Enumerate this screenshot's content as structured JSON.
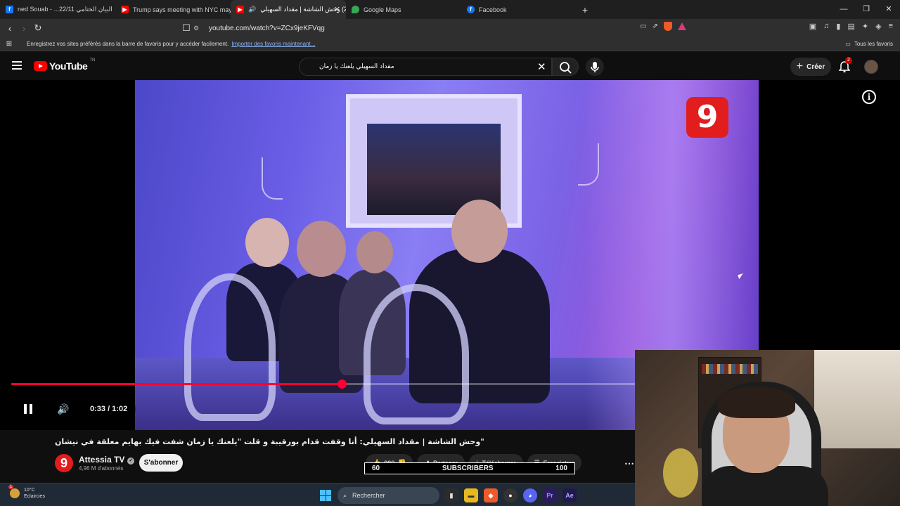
{
  "browser": {
    "tabs": [
      {
        "title": "ned Souab - ...22/11 البيان الختامي",
        "favicon": "facebook-icon",
        "color": "#1877f2"
      },
      {
        "title": "Trump says meeting with NYC mayor",
        "favicon": "youtube-icon",
        "color": "#ff0000"
      },
      {
        "title": "(2) وحش الشاشة | مقداد السهيلي",
        "favicon": "youtube-icon",
        "color": "#ff0000",
        "active": true
      },
      {
        "title": "Google Maps",
        "favicon": "maps-icon",
        "color": "#34a853"
      },
      {
        "title": "Facebook",
        "favicon": "facebook-icon",
        "color": "#1877f2"
      }
    ],
    "new_tab": "+",
    "url": "youtube.com/watch?v=ZCx9jeKFVqg",
    "bookmarks_hint": "Enregistrez vos sites préférés dans la barre de favoris pour y accéder facilement.",
    "bookmarks_link": "Importer des favoris maintenant...",
    "all_bookmarks": "Tous les favoris"
  },
  "youtube": {
    "logo_text": "YouTube",
    "logo_region": "TN",
    "search_value": "مقداد السهيلي يلعنك يا زمان",
    "create_label": "Créer",
    "notification_count": "2",
    "video": {
      "channel_bug": "9",
      "current_time": "0:33",
      "duration": "1:02",
      "time_display": "0:33 / 1:02",
      "progress": 0.53
    },
    "title": "\"وحش الشاشة | مقداد السهيلي: أنا وقفت قدام بورقيبة و قلت \"يلعنك يا زمان شفت فيك بهايم معلقة في نيشان",
    "channel": {
      "name": "Attessia TV",
      "subscribers": "4,96 M d'abonnés",
      "logo": "9"
    },
    "subscribe_label": "S'abonner",
    "actions": {
      "likes": "990",
      "share": "Partager",
      "download": "Télécharger",
      "save": "Enregistrer"
    }
  },
  "overlay": {
    "left": "60",
    "label": "SUBSCRIBERS",
    "right": "100"
  },
  "taskbar": {
    "weather_badge": "1",
    "temperature": "10°C",
    "condition": "Eclaircies",
    "search_placeholder": "Rechercher"
  },
  "colors": {
    "youtube_red": "#ff0000",
    "progress": "#ff0033",
    "channel_red": "#e11d1d"
  }
}
